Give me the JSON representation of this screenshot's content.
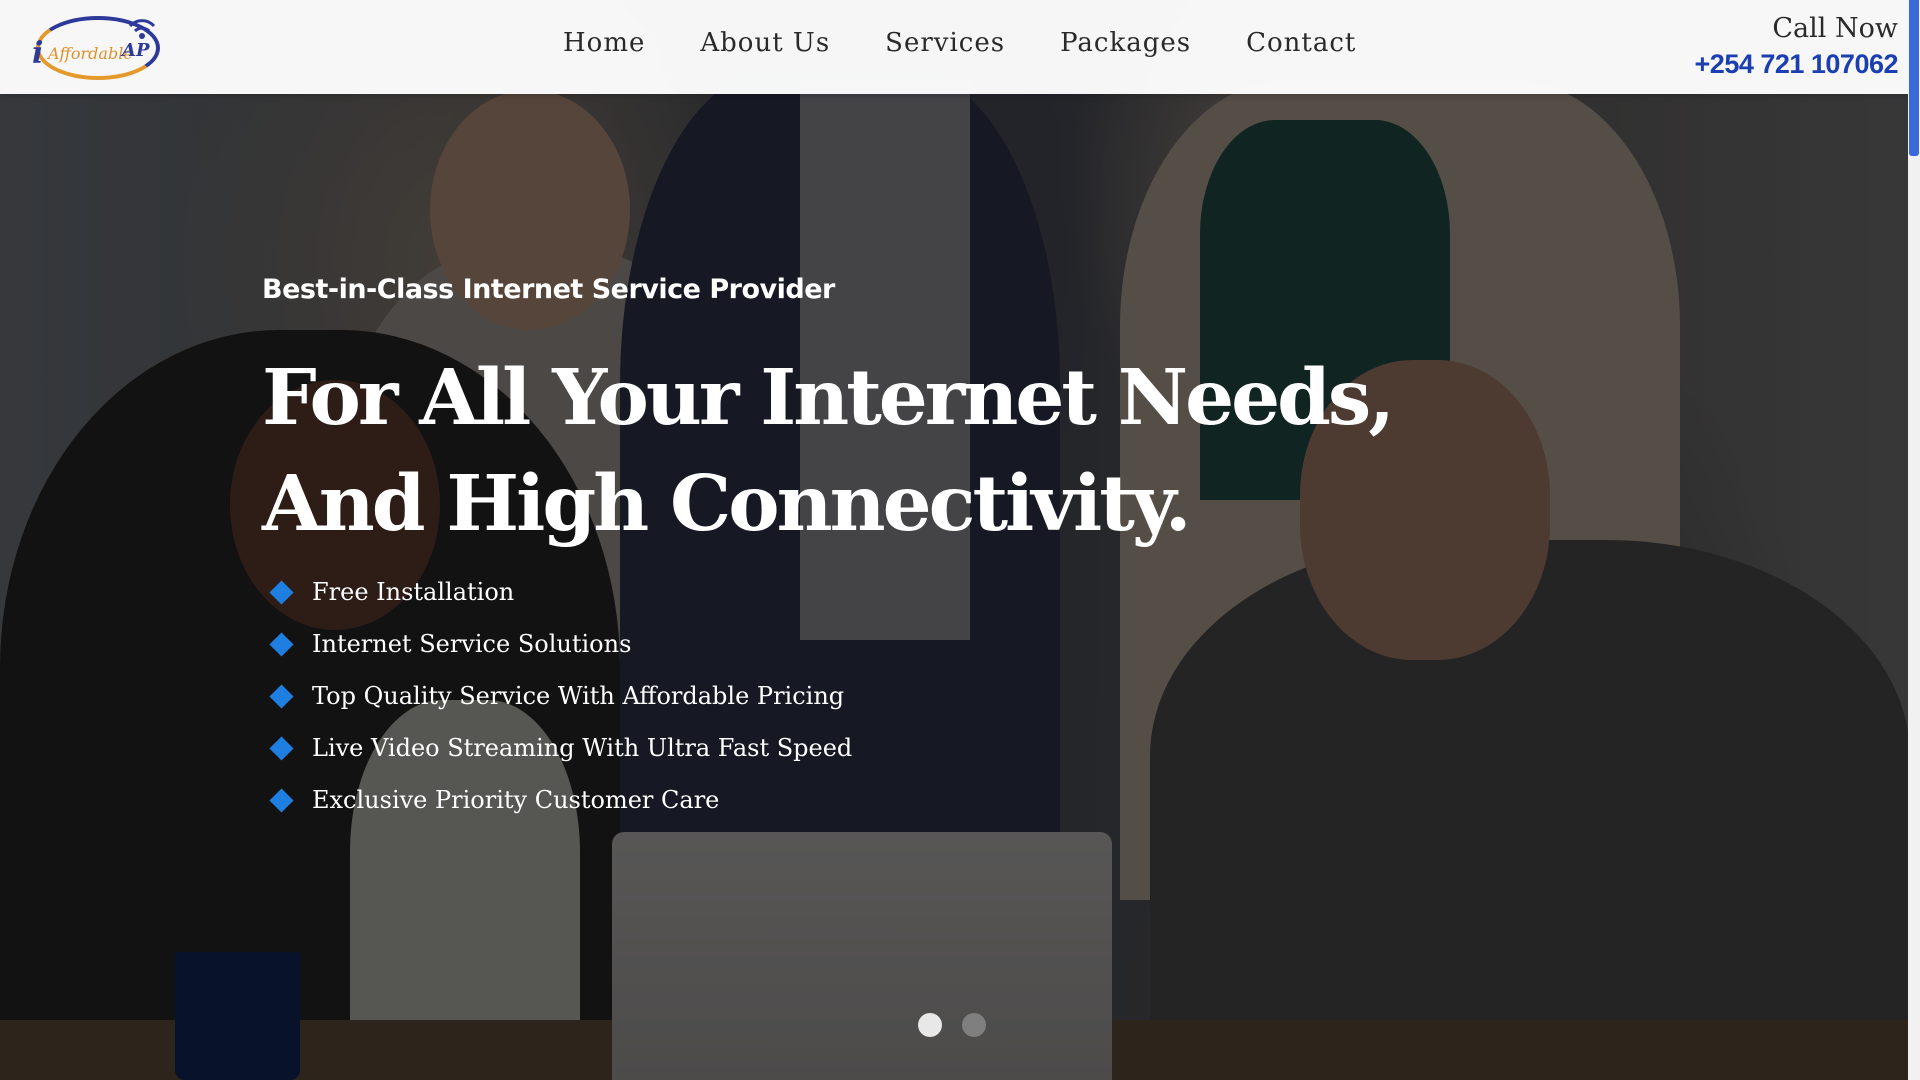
{
  "logo": {
    "i": "i",
    "word": "Affordable",
    "ap": "AP"
  },
  "nav": {
    "items": [
      {
        "label": "Home"
      },
      {
        "label": "About Us"
      },
      {
        "label": "Services"
      },
      {
        "label": "Packages"
      },
      {
        "label": "Contact"
      }
    ]
  },
  "call": {
    "label": "Call Now",
    "phone": "+254 721 107062"
  },
  "hero": {
    "eyebrow": "Best-in-Class Internet Service Provider",
    "headline_line1": "For All Your Internet Needs,",
    "headline_line2": "And High Connectivity.",
    "features": [
      "Free Installation",
      "Internet Service Solutions",
      "Top Quality Service With Affordable Pricing",
      "Live Video Streaming With Ultra Fast Speed",
      "Exclusive Priority Customer Care"
    ],
    "slides": {
      "count": 2,
      "active": 1
    }
  },
  "colors": {
    "accent_blue": "#1f7fe0",
    "phone_blue": "#1b3fb0",
    "logo_navy": "#2d3a9a",
    "logo_orange": "#e39a2b",
    "scroll_thumb": "#3a6ad9"
  }
}
